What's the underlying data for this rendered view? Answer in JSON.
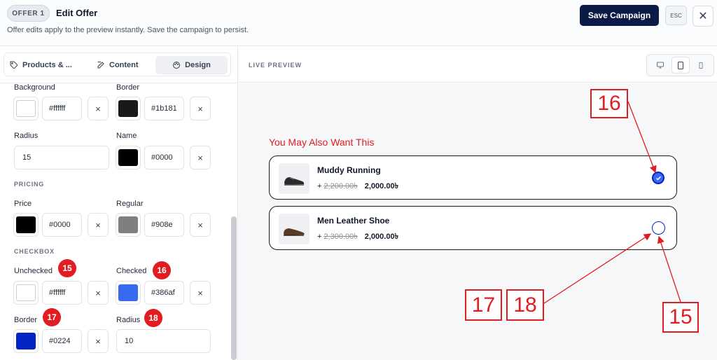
{
  "header": {
    "offer_badge": "OFFER 1",
    "title": "Edit Offer",
    "note": "Offer edits apply to the preview instantly. Save the campaign to persist.",
    "save_label": "Save Campaign",
    "esc_label": "ESC",
    "close_glyph": "✕"
  },
  "tabs": [
    {
      "label": "Products & ...",
      "icon": "tag-icon",
      "active": false
    },
    {
      "label": "Content",
      "icon": "edit-icon",
      "active": false
    },
    {
      "label": "Design",
      "icon": "palette-icon",
      "active": true
    }
  ],
  "design": {
    "background": {
      "label": "Background",
      "value": "#ffffff",
      "color": "#ffffff"
    },
    "border": {
      "label": "Border",
      "value": "#1b181",
      "color": "#1b1818"
    },
    "radius": {
      "label": "Radius",
      "value": "15"
    },
    "name": {
      "label": "Name",
      "value": "#0000",
      "color": "#000000"
    },
    "pricing_section": "PRICING",
    "price": {
      "label": "Price",
      "value": "#0000",
      "color": "#000000"
    },
    "regular": {
      "label": "Regular",
      "value": "#908e",
      "color": "#908e8e"
    },
    "checkbox_section": "CHECKBOX",
    "unchecked": {
      "label": "Unchecked",
      "value": "#ffffff",
      "color": "#ffffff"
    },
    "checked": {
      "label": "Checked",
      "value": "#386af",
      "color": "#386af1"
    },
    "cb_border": {
      "label": "Border",
      "value": "#0224",
      "color": "#0224c4"
    },
    "cb_radius": {
      "label": "Radius",
      "value": "10"
    },
    "clear_glyph": "×"
  },
  "preview": {
    "label": "LIVE PREVIEW",
    "devices": [
      "desktop-icon",
      "tablet-icon",
      "mobile-icon"
    ],
    "heading": "You May Also Want This",
    "products": [
      {
        "name": "Muddy Running",
        "prefix": "+",
        "regular": "2,200.00৳",
        "sale": "2,000.00৳",
        "checked": true
      },
      {
        "name": "Men Leather Shoe",
        "prefix": "+",
        "regular": "2,300.00৳",
        "sale": "2,000.00৳",
        "checked": false
      }
    ]
  },
  "badges": {
    "b15": "15",
    "b16": "16",
    "b17": "17",
    "b18": "18"
  },
  "callouts": {
    "c16": "16",
    "c17": "17",
    "c18": "18",
    "c15": "15"
  },
  "colors": {
    "accent": "#e11d21",
    "primary": "#0b1b46"
  }
}
